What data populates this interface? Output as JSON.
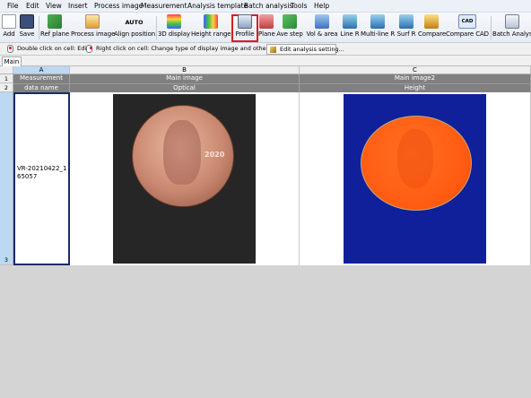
{
  "menu": [
    "File",
    "Edit",
    "View",
    "Insert",
    "Process image",
    "Measurement",
    "Analysis template",
    "Batch analysis",
    "Tools",
    "Help"
  ],
  "toolbar": [
    "Add",
    "Save",
    "Ref plane",
    "Process image",
    "Align position",
    "3D display",
    "Height range",
    "Profile",
    "Plane",
    "Ave step",
    "Vol & area",
    "Line R",
    "Multi-line R",
    "Surf R",
    "Compare",
    "Compare CAD",
    "Batch Analysis"
  ],
  "auto_label": "AUTO",
  "cad_label": "CAD",
  "hints": {
    "double_click": "Double click on cell: Edit",
    "right_click": "Right click on cell: Change type of display image and other actions",
    "edit_button": "Edit analysis setting..."
  },
  "tab": "Main",
  "grid": {
    "columns": [
      "A",
      "B",
      "C"
    ],
    "rows": [
      "1",
      "2",
      "3"
    ],
    "row1": [
      "Measurement",
      "Main image",
      "Main image2"
    ],
    "row2": [
      "data name",
      "Optical",
      "Height"
    ],
    "data_name": "VR-20210422_165057",
    "coin_year": "2020"
  },
  "colors": {
    "highlight": "#d42020",
    "height_bg": "#10209a",
    "height_coin": "#ff5a10",
    "selected_col": "#bcd8f2"
  }
}
